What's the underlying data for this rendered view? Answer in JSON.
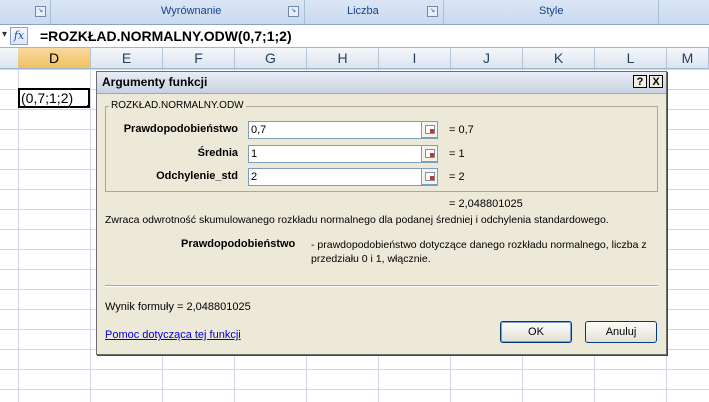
{
  "ribbon": {
    "groups": [
      "Wyrównanie",
      "Liczba",
      "Style"
    ]
  },
  "formula_bar": {
    "fx_label": "fx",
    "formula": "=ROZKŁAD.NORMALNY.ODW(0,7;1;2)"
  },
  "columns": [
    "D",
    "E",
    "F",
    "G",
    "H",
    "I",
    "J",
    "K",
    "L",
    "M"
  ],
  "active_cell": {
    "text": "(0,7;1;2)"
  },
  "dialog": {
    "title": "Argumenty funkcji",
    "help_button": "?",
    "close_button": "X",
    "function_name": "ROZKŁAD.NORMALNY.ODW",
    "args": [
      {
        "label": "Prawdopodobieństwo",
        "value": "0,7",
        "result": "=  0,7"
      },
      {
        "label": "Średnia",
        "value": "1",
        "result": "=  1"
      },
      {
        "label": "Odchylenie_std",
        "value": "2",
        "result": "=  2"
      }
    ],
    "overall_result": "=  2,048801025",
    "description": "Zwraca odwrotność skumulowanego rozkładu normalnego dla podanej średniej i odchylenia standardowego.",
    "param_name": "Prawdopodobieństwo",
    "param_description": "- prawdopodobieństwo dotyczące danego rozkładu normalnego, liczba z przedziału 0 i 1, włącznie.",
    "formula_result": "Wynik formuły =   2,048801025",
    "help_link": "Pomoc dotycząca tej funkcji",
    "ok_label": "OK",
    "cancel_label": "Anuluj"
  }
}
